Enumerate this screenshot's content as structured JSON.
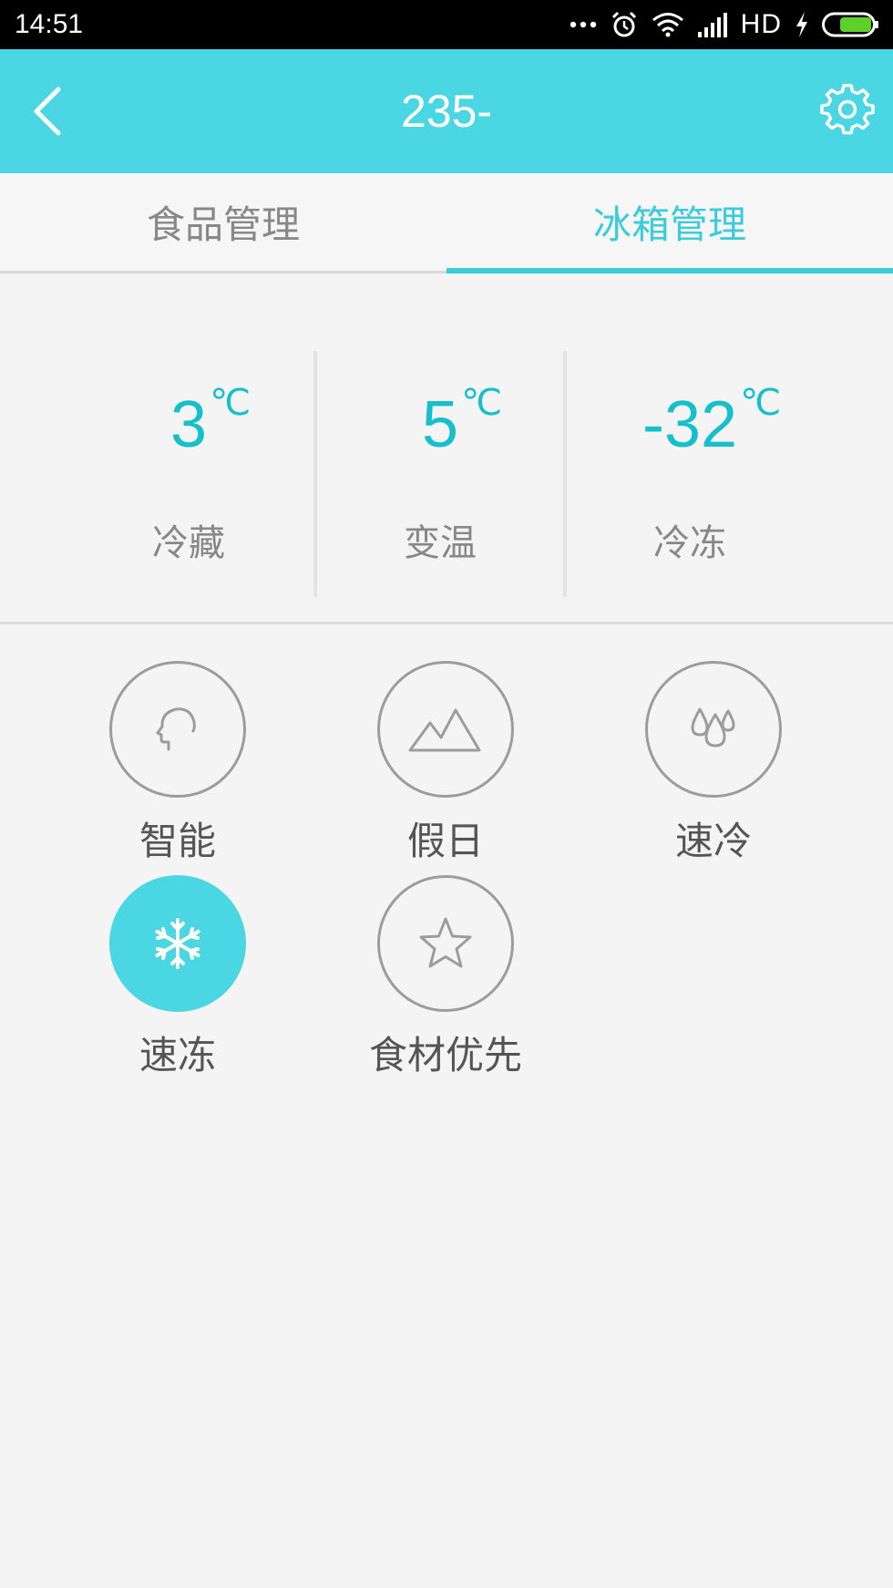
{
  "status_bar": {
    "time": "14:51",
    "network": "HD",
    "icons": [
      "more-dots-icon",
      "alarm-icon",
      "wifi-icon",
      "signal-icon",
      "charging-icon",
      "battery-icon"
    ]
  },
  "header": {
    "title": "235-",
    "back_icon": "chevron-left-icon",
    "settings_icon": "gear-icon"
  },
  "tabs": [
    {
      "label": "食品管理",
      "active": false
    },
    {
      "label": "冰箱管理",
      "active": true
    }
  ],
  "zones": [
    {
      "value": "3",
      "unit": "℃",
      "label": "冷藏"
    },
    {
      "value": "5",
      "unit": "℃",
      "label": "变温"
    },
    {
      "value": "-32",
      "unit": "℃",
      "label": "冷冻"
    }
  ],
  "modes": [
    {
      "label": "智能",
      "icon": "head-profile-icon",
      "active": false
    },
    {
      "label": "假日",
      "icon": "mountain-icon",
      "active": false
    },
    {
      "label": "速冷",
      "icon": "water-drops-icon",
      "active": false
    },
    {
      "label": "速冻",
      "icon": "snowflake-icon",
      "active": true
    },
    {
      "label": "食材优先",
      "icon": "star-icon",
      "active": false
    }
  ],
  "colors": {
    "accent": "#4bd6e3",
    "temp_text": "#15bfcc",
    "tab_active": "#3ccbd9"
  }
}
